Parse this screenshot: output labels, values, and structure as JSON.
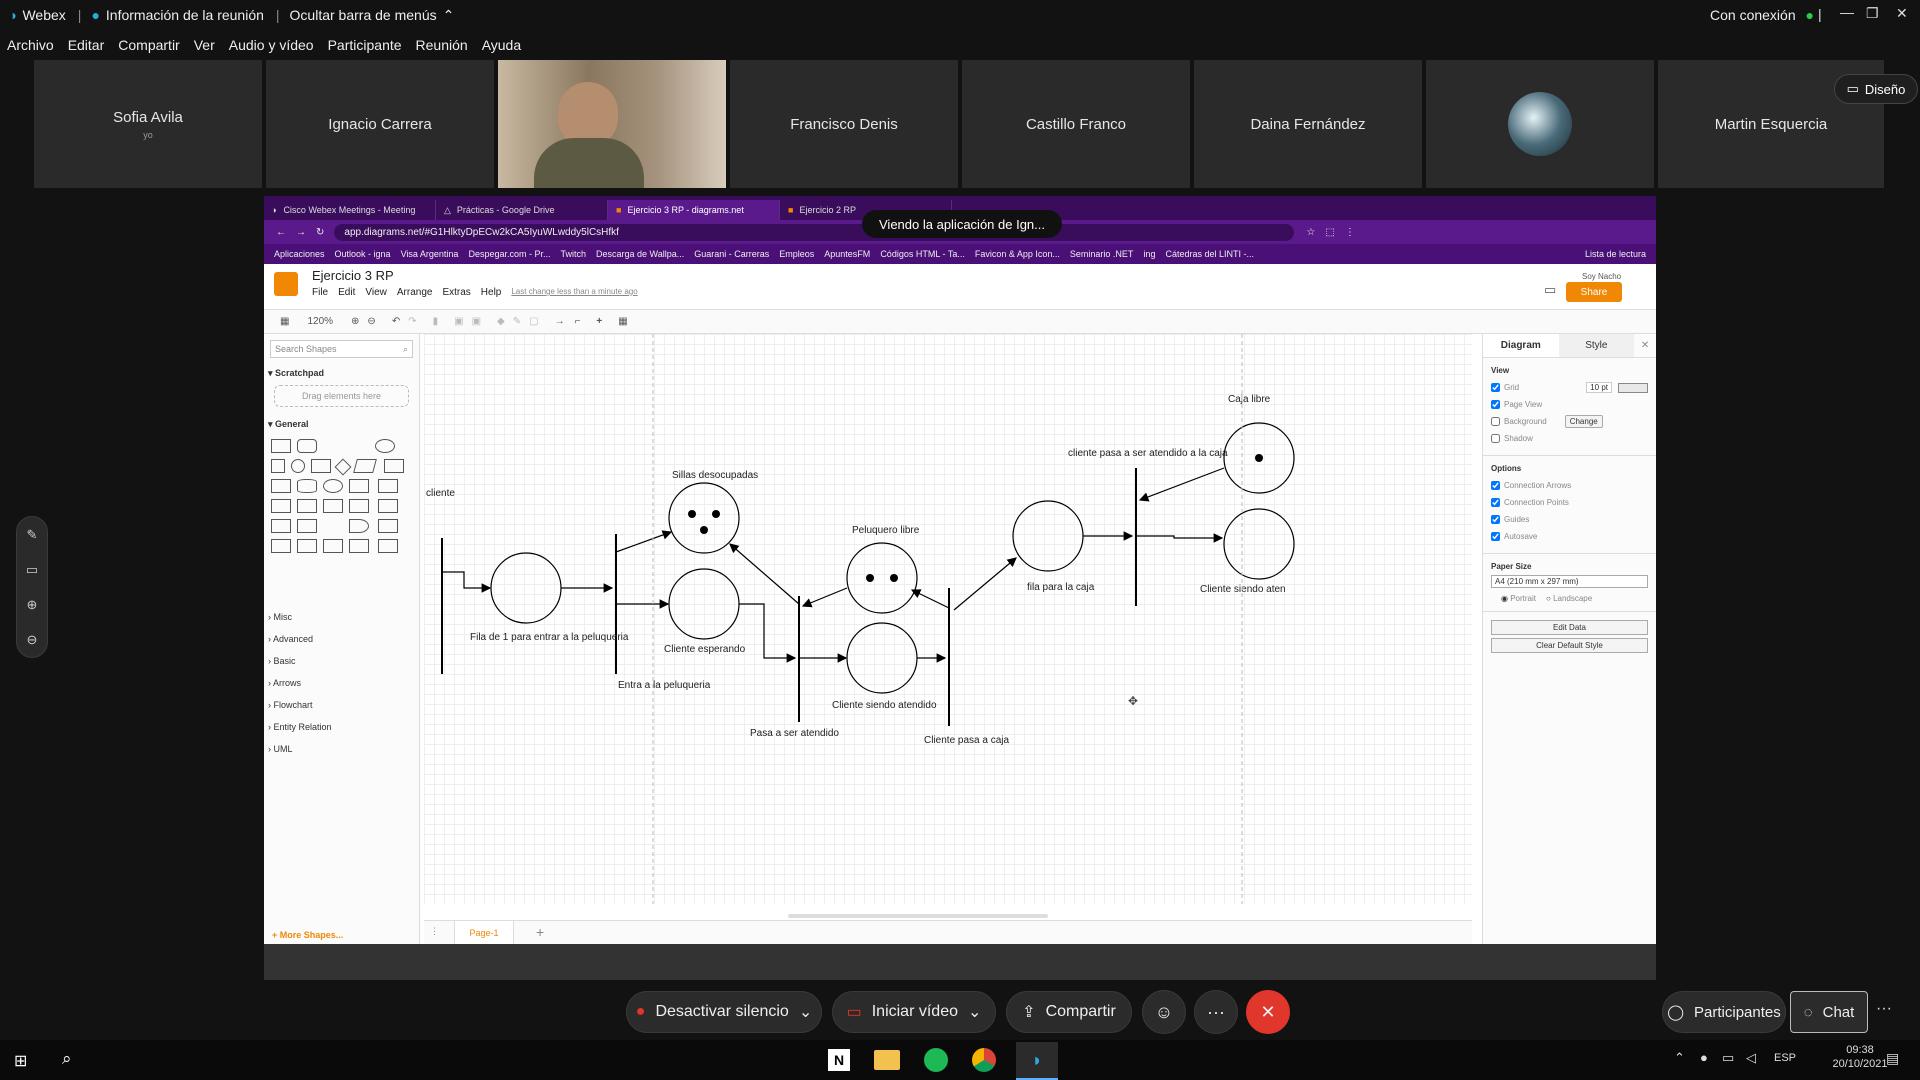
{
  "webex": {
    "app_name": "Webex",
    "meeting_info": "Información de la reunión",
    "hide_menu": "Ocultar barra de menús",
    "connection": "Con conexión",
    "menu": [
      "Archivo",
      "Editar",
      "Compartir",
      "Ver",
      "Audio y vídeo",
      "Participante",
      "Reunión",
      "Ayuda"
    ],
    "layout_button": "Diseño",
    "participants": [
      {
        "name": "Sofia Avila",
        "sub": "yo"
      },
      {
        "name": "Ignacio Carrera",
        "sub": ""
      },
      {
        "name": "",
        "sub": ""
      },
      {
        "name": "Francisco Denis",
        "sub": ""
      },
      {
        "name": "Castillo Franco",
        "sub": ""
      },
      {
        "name": "Daina Fernández",
        "sub": ""
      },
      {
        "name": "",
        "sub": ""
      },
      {
        "name": "Martin Esquercia",
        "sub": ""
      }
    ],
    "viewing_banner": "Viendo la aplicación de Ign...",
    "controls": {
      "mute": "Desactivar silencio",
      "video": "Iniciar vídeo",
      "share": "Compartir",
      "participants": "Participantes",
      "chat": "Chat"
    },
    "status_color": "#2ecc40",
    "end_color": "#e0362b"
  },
  "browser": {
    "tabs": [
      "Cisco Webex Meetings - Meeting",
      "Prácticas - Google Drive",
      "Ejercicio 3 RP - diagrams.net",
      "Ejercicio 2 RP"
    ],
    "url": "app.diagrams.net/#G1HlktyDpECw2kCA5IyuWLwddy5lCsHfkf",
    "bookmarks": [
      "Aplicaciones",
      "Outlook - igna",
      "Visa Argentina",
      "Despegar.com - Pr...",
      "Twitch",
      "Descarga de Wallpa...",
      "Guarani - Carreras",
      "Empleos",
      "ApuntesFM",
      "Códigos HTML - Ta...",
      "Favicon & App Icon...",
      "Seminario .NET",
      "ing",
      "Cátedras del LINTI -..."
    ],
    "reading_list": "Lista de lectura"
  },
  "drawio": {
    "title": "Ejercicio 3 RP",
    "menu": [
      "File",
      "Edit",
      "View",
      "Arrange",
      "Extras",
      "Help"
    ],
    "last_change": "Last change less than a minute ago",
    "user": "Soy Nacho",
    "share": "Share",
    "zoom": "120%",
    "search_placeholder": "Search Shapes",
    "scratchpad": "Scratchpad",
    "drag_here": "Drag elements here",
    "general": "General",
    "sections": [
      "Misc",
      "Advanced",
      "Basic",
      "Arrows",
      "Flowchart",
      "Entity Relation",
      "UML"
    ],
    "more_shapes": "+ More Shapes...",
    "page_tab": "Page-1",
    "right": {
      "tab_diagram": "Diagram",
      "tab_style": "Style",
      "view": "View",
      "grid": "Grid",
      "grid_size": "10 pt",
      "page_view": "Page View",
      "background": "Background",
      "change": "Change",
      "shadow": "Shadow",
      "options": "Options",
      "connection_arrows": "Connection Arrows",
      "connection_points": "Connection Points",
      "guides": "Guides",
      "autosave": "Autosave",
      "paper_size": "Paper Size",
      "paper_value": "A4 (210 mm x 297 mm)",
      "portrait": "Portrait",
      "landscape": "Landscape",
      "edit_data": "Edit Data",
      "clear_style": "Clear Default Style"
    },
    "labels": {
      "cliente": "cliente",
      "fila": "Fila de 1 para entrar a la peluqueria",
      "entra": "Entra a la peluqueria",
      "sillas": "Sillas desocupadas",
      "esperando": "Cliente esperando",
      "pasa": "Pasa a ser atendido",
      "peluquero": "Peluquero libre",
      "siendo": "Cliente  siendo atendido",
      "pasa_caja": "Cliente pasa a caja",
      "fila_caja": "fila para la caja",
      "atendido_caja": "cliente pasa a ser atendido a la caja",
      "caja_libre": "Caja libre",
      "siendo_caja": "Cliente siendo aten"
    }
  },
  "taskbar": {
    "lang": "ESP",
    "time": "09:38",
    "date": "20/10/2021"
  }
}
